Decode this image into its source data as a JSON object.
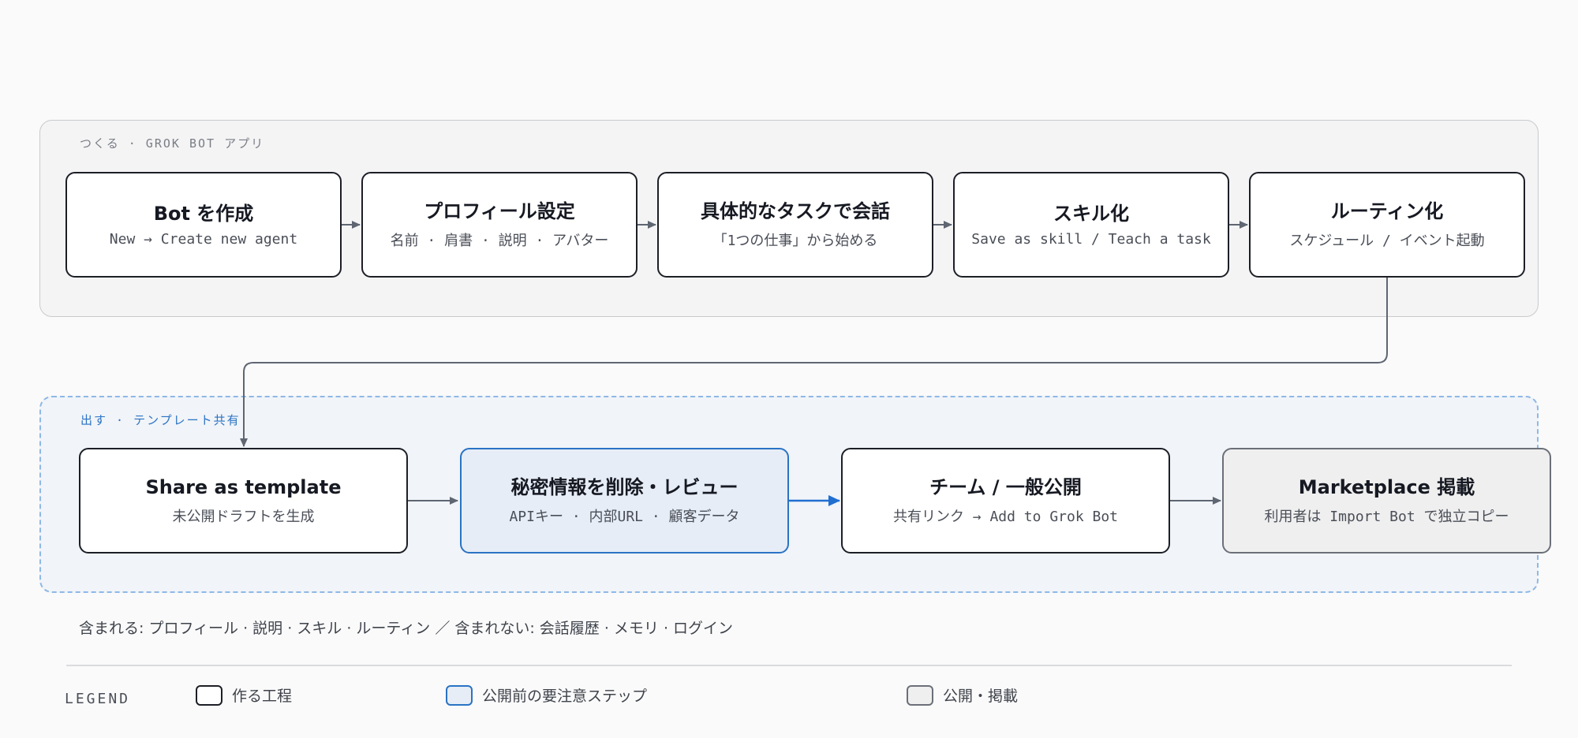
{
  "groups": {
    "make": "つくる · GROK BOT アプリ",
    "ship": "出す · テンプレート共有"
  },
  "nodes": [
    {
      "title": "Bot を作成",
      "sub": "New → Create new agent"
    },
    {
      "title": "プロフィール設定",
      "sub": "名前 · 肩書 · 説明 · アバター"
    },
    {
      "title": "具体的なタスクで会話",
      "sub": "「1つの仕事」から始める"
    },
    {
      "title": "スキル化",
      "sub": "Save as skill / Teach a task"
    },
    {
      "title": "ルーティン化",
      "sub": "スケジュール / イベント起動"
    },
    {
      "title": "Share as template",
      "sub": "未公開ドラフトを生成"
    },
    {
      "title": "秘密情報を削除・レビュー",
      "sub": "APIキー · 内部URL · 顧客データ"
    },
    {
      "title": "チーム / 一般公開",
      "sub": "共有リンク → Add to Grok Bot"
    },
    {
      "title": "Marketplace 掲載",
      "sub": "利用者は Import Bot で独立コピー"
    }
  ],
  "note": "含まれる: プロフィール · 説明 · スキル · ルーティン ／ 含まれない: 会話履歴 · メモリ · ログイン",
  "legend": {
    "title": "LEGEND",
    "items": [
      "作る工程",
      "公開前の要注意ステップ",
      "公開・掲載"
    ]
  },
  "colors": {
    "edge": "#5f6672",
    "accent": "#1f6fd0",
    "node_border": "#1c1f26",
    "caution_fill": "#e6edf6",
    "publish_fill": "#efefef"
  }
}
